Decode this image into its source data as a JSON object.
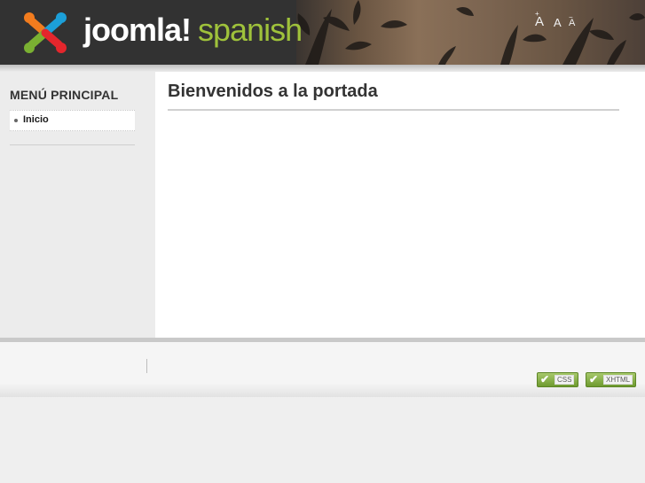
{
  "header": {
    "logo_word": "joomla!",
    "logo_suffix": "spanish",
    "font_size_controls": {
      "increase": "A",
      "increase_mark": "+",
      "normal": "A",
      "decrease": "A",
      "decrease_mark": "−"
    }
  },
  "sidebar": {
    "menu_title": "MENÚ PRINCIPAL",
    "items": [
      {
        "label": "Inicio"
      }
    ]
  },
  "main": {
    "title": "Bienvenidos a la portada"
  },
  "footer": {
    "badges": [
      {
        "label": "CSS"
      },
      {
        "label": "XHTML"
      }
    ]
  },
  "colors": {
    "header_bg": "#323232",
    "logo_accent": "#9fc23b",
    "badge_green": "#6e9a2f"
  }
}
